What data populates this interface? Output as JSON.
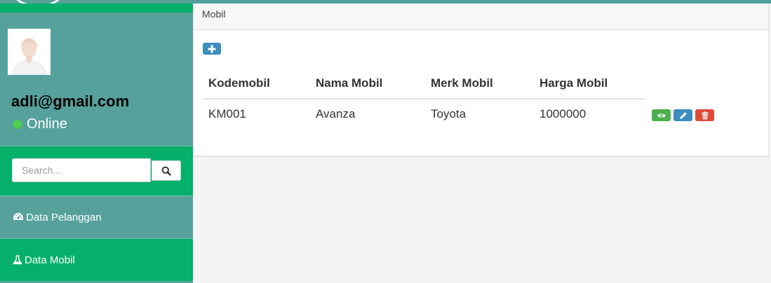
{
  "sidebar": {
    "user": {
      "email": "adli@gmail.com",
      "status": "Online"
    },
    "search": {
      "placeholder": "Search..."
    },
    "items": [
      {
        "label": "Data Pelanggan",
        "icon": "dashboard-icon"
      },
      {
        "label": "Data Mobil",
        "icon": "flask-icon"
      }
    ]
  },
  "main": {
    "box_title": "Mobil",
    "table": {
      "headers": [
        "Kodemobil",
        "Nama Mobil",
        "Merk Mobil",
        "Harga Mobil"
      ],
      "rows": [
        [
          "KM001",
          "Avanza",
          "Toyota",
          "1000000"
        ]
      ],
      "row_actions": [
        "view-icon",
        "edit-icon",
        "delete-icon"
      ]
    }
  },
  "colors": {
    "sidebar_teal": "#56a19c",
    "sidebar_green": "#05b06a",
    "primary_blue": "#3c8dbc",
    "success_green": "#4cae4c",
    "danger_red": "#dd4b39",
    "status_online": "#4cce4f"
  }
}
